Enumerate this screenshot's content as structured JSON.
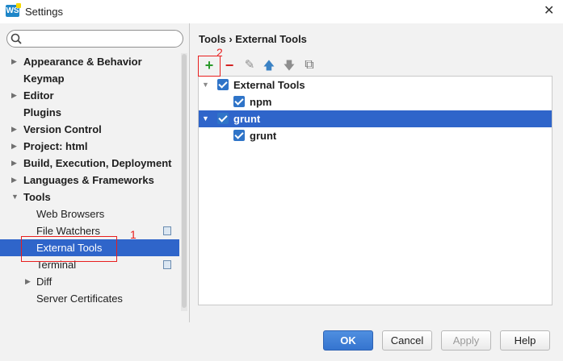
{
  "window": {
    "app_icon_text": "WS",
    "title": "Settings",
    "close_glyph": "✕"
  },
  "sidebar": {
    "search": {
      "value": "",
      "placeholder": ""
    },
    "items": [
      {
        "label": "Appearance & Behavior",
        "bold": true,
        "arrow": "▶",
        "level": 0
      },
      {
        "label": "Keymap",
        "bold": true,
        "arrow": "",
        "level": 0
      },
      {
        "label": "Editor",
        "bold": true,
        "arrow": "▶",
        "level": 0
      },
      {
        "label": "Plugins",
        "bold": true,
        "arrow": "",
        "level": 0
      },
      {
        "label": "Version Control",
        "bold": true,
        "arrow": "▶",
        "level": 0
      },
      {
        "label": "Project: html",
        "bold": true,
        "arrow": "▶",
        "level": 0
      },
      {
        "label": "Build, Execution, Deployment",
        "bold": true,
        "arrow": "▶",
        "level": 0
      },
      {
        "label": "Languages & Frameworks",
        "bold": true,
        "arrow": "▶",
        "level": 0
      },
      {
        "label": "Tools",
        "bold": true,
        "arrow": "▼",
        "level": 0
      },
      {
        "label": "Web Browsers",
        "bold": false,
        "arrow": "",
        "level": 1
      },
      {
        "label": "File Watchers",
        "bold": false,
        "arrow": "",
        "level": 1,
        "icon": "copy-icon"
      },
      {
        "label": "External Tools",
        "bold": false,
        "arrow": "",
        "level": 1,
        "selected": true
      },
      {
        "label": "Terminal",
        "bold": false,
        "arrow": "",
        "level": 1,
        "icon": "copy-icon"
      },
      {
        "label": "Diff",
        "bold": false,
        "arrow": "▶",
        "level": 1
      },
      {
        "label": "Server Certificates",
        "bold": false,
        "arrow": "",
        "level": 1
      }
    ]
  },
  "breadcrumb": {
    "parent": "Tools",
    "separator": "›",
    "current": "External Tools"
  },
  "toolbar": {
    "add": "+",
    "remove": "−",
    "edit": "✎",
    "move_up": "🡅",
    "move_down": "🡇",
    "copy": "⧉"
  },
  "tool_tree": [
    {
      "label": "External Tools",
      "level": 0,
      "expanded": true,
      "checked": true,
      "selected": false
    },
    {
      "label": "npm",
      "level": 1,
      "checked": true,
      "selected": false
    },
    {
      "label": "grunt",
      "level": 0,
      "expanded": true,
      "checked": true,
      "selected": true
    },
    {
      "label": "grunt",
      "level": 1,
      "checked": true,
      "selected": false
    }
  ],
  "annotations": {
    "one": "1",
    "two": "2"
  },
  "buttons": {
    "ok": "OK",
    "cancel": "Cancel",
    "apply": "Apply",
    "help": "Help"
  },
  "colors": {
    "accent": "#2f65ca",
    "annotation": "#e81e1e"
  }
}
